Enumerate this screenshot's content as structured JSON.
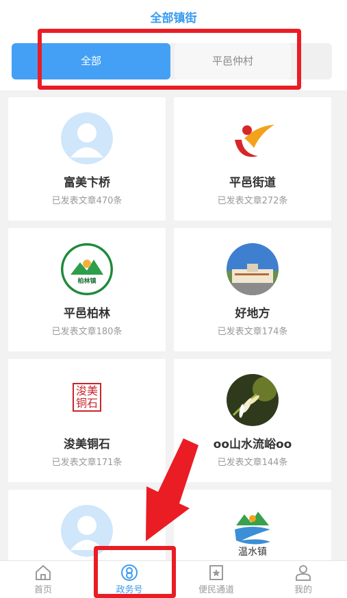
{
  "header": {
    "title": "全部镇街",
    "tabs": [
      {
        "label": "全部",
        "active": true
      },
      {
        "label": "平邑仲村",
        "active": false
      }
    ]
  },
  "accounts": [
    {
      "name": "富美卞桥",
      "count": "已发表文章470条",
      "avatar_icon": "default-user-icon"
    },
    {
      "name": "平邑街道",
      "count": "已发表文章272条",
      "avatar_icon": "party-logo-icon"
    },
    {
      "name": "平邑柏林",
      "count": "已发表文章180条",
      "avatar_icon": "bailin-logo-icon"
    },
    {
      "name": "好地方",
      "count": "已发表文章174条",
      "avatar_icon": "building-photo-icon"
    },
    {
      "name": "浚美铜石",
      "count": "已发表文章171条",
      "avatar_icon": "seal-logo-icon"
    },
    {
      "name": "oo山水流峪oo",
      "count": "已发表文章144条",
      "avatar_icon": "flower-photo-icon"
    },
    {
      "name": "",
      "count": "",
      "avatar_icon": "default-user-icon"
    },
    {
      "name": "",
      "count": "",
      "avatar_icon": "wenshui-logo-icon"
    }
  ],
  "logos": {
    "wenshui_text": "温水镇",
    "bailin_text": "柏林镇",
    "seal_text": "浚美铜石"
  },
  "nav": [
    {
      "label": "首页",
      "icon": "home-icon",
      "active": false
    },
    {
      "label": "政务号",
      "icon": "gov-account-icon",
      "active": true
    },
    {
      "label": "便民通道",
      "icon": "star-bookmark-icon",
      "active": false
    },
    {
      "label": "我的",
      "icon": "user-icon",
      "active": false
    }
  ],
  "colors": {
    "accent": "#44a0f4",
    "annotation_red": "#ea1c24"
  }
}
